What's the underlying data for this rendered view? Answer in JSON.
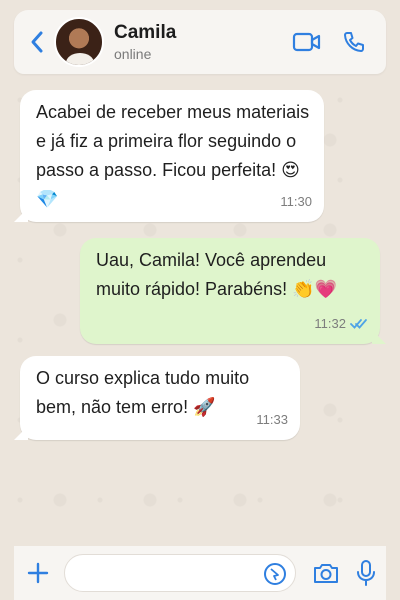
{
  "header": {
    "contact_name": "Camila",
    "status": "online",
    "icons": {
      "back": "chevron-left-icon",
      "video": "video-call-icon",
      "phone": "phone-icon"
    }
  },
  "messages": [
    {
      "direction": "in",
      "text": "Acabei de receber meus materiais e já fiz a primeira flor seguindo o passo a passo. Ficou perfeita! 😍💎",
      "time": "11:30"
    },
    {
      "direction": "out",
      "text": "Uau, Camila! Você aprendeu muito rápido! Parabéns! 👏💗",
      "time": "11:32",
      "status": "read"
    },
    {
      "direction": "in",
      "text": "O curso explica tudo muito bem, não tem erro! 🚀",
      "time": "11:33"
    }
  ],
  "composer": {
    "placeholder": "",
    "icons": {
      "attach": "plus-icon",
      "sticker": "sticker-icon",
      "camera": "camera-icon",
      "mic": "microphone-icon"
    }
  },
  "colors": {
    "accent": "#2f7fe0",
    "incoming_bubble": "#ffffff",
    "outgoing_bubble": "#dff5cc",
    "read_ticks": "#4fa3e6"
  }
}
